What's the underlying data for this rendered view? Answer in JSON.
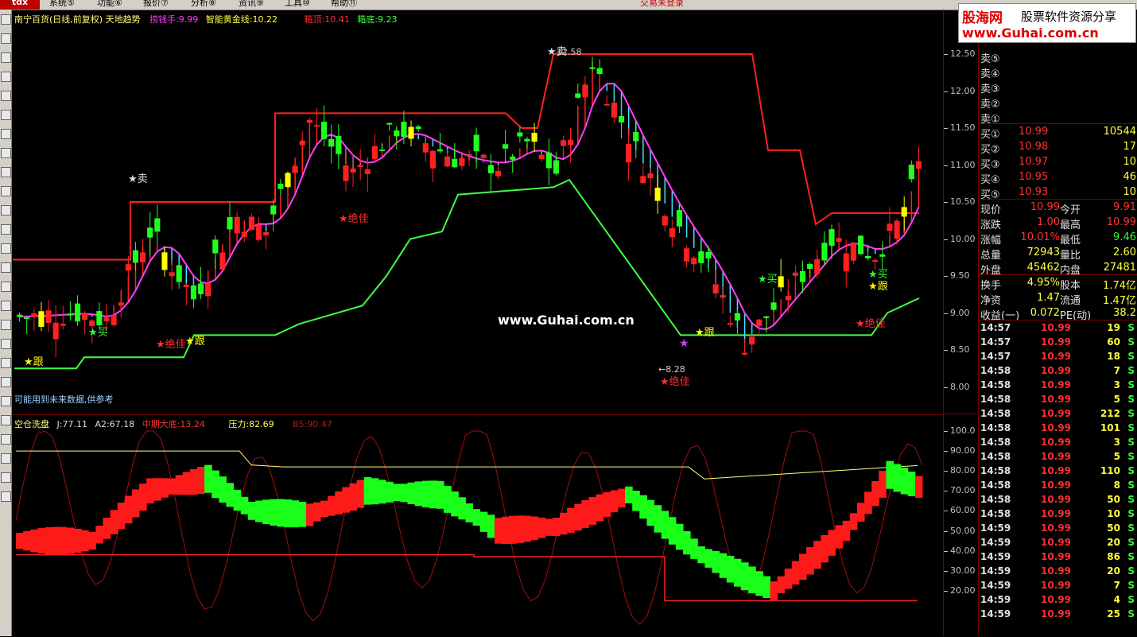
{
  "menu": {
    "items": [
      "系统⑤",
      "功能⑥",
      "报价⑦",
      "分析⑧",
      "资讯⑨",
      "工具⑩",
      "帮助⑪"
    ],
    "login_status": "交易未登录"
  },
  "watermark": {
    "site": "股海网",
    "slogan": "股票软件资源分享",
    "url": "www.Guhai.com.cn"
  },
  "main_header": {
    "title": "南宁百货(日线,前复权) 天地趋势",
    "ind1_label": "捞钱手:",
    "ind1_value": "9.99",
    "ind2_label": "智能黄金线:",
    "ind2_value": "10.22",
    "ind3_label": "箱顶:",
    "ind3_value": "10.41",
    "ind4_label": "箱底:",
    "ind4_value": "9.23"
  },
  "main_footer_note": "可能用到未来数据,供参考",
  "center_watermark": "www.Guhai.com.cn",
  "sub_header": {
    "title": "空仓洗盘",
    "j": "J:77.11",
    "a2": "A2:67.18",
    "mid_label": "中期大底:",
    "mid_value": "13.24",
    "press_label": "压力:",
    "press_value": "82.69",
    "b5": "B5:90.47"
  },
  "annotations": {
    "sell": "★卖",
    "buy": "★买",
    "follow": "★跟",
    "best": "★绝佳",
    "high_mark": "12.58",
    "low_mark": "←8.28"
  },
  "price_axis": [
    "12.50",
    "12.00",
    "11.50",
    "11.00",
    "10.50",
    "10.00",
    "9.50",
    "9.00",
    "8.50",
    "8.00"
  ],
  "sub_axis": [
    "100.0",
    "90.00",
    "80.00",
    "70.00",
    "60.00",
    "50.00",
    "40.00",
    "30.00",
    "20.00"
  ],
  "quote": {
    "sell_labels": [
      "卖⑤",
      "卖④",
      "卖③",
      "卖②",
      "卖①"
    ],
    "buy_levels": [
      {
        "label": "买①",
        "price": "10.99",
        "vol": "10544"
      },
      {
        "label": "买②",
        "price": "10.98",
        "vol": "17"
      },
      {
        "label": "买③",
        "price": "10.97",
        "vol": "10"
      },
      {
        "label": "买④",
        "price": "10.95",
        "vol": "46"
      },
      {
        "label": "买⑤",
        "price": "10.93",
        "vol": "10"
      }
    ],
    "stats": [
      {
        "l1": "现价",
        "v1": "10.99",
        "l2": "今开",
        "v2": "9.91"
      },
      {
        "l1": "涨跌",
        "v1": "1.00",
        "l2": "最高",
        "v2": "10.99"
      },
      {
        "l1": "涨幅",
        "v1": "10.01%",
        "l2": "最低",
        "v2": "9.46"
      },
      {
        "l1": "总量",
        "v1": "72943",
        "l2": "量比",
        "v2": "2.60"
      },
      {
        "l1": "外盘",
        "v1": "45462",
        "l2": "内盘",
        "v2": "27481"
      }
    ],
    "stats2": [
      {
        "l1": "换手",
        "v1": "4.95%",
        "l2": "股本",
        "v2": "1.74亿"
      },
      {
        "l1": "净资",
        "v1": "1.47",
        "l2": "流通",
        "v2": "1.47亿"
      },
      {
        "l1": "收益(一)",
        "v1": "0.072",
        "l2": "PE(动)",
        "v2": "38.2"
      }
    ],
    "ticks": [
      {
        "t": "14:57",
        "p": "10.99",
        "v": "19",
        "s": "S"
      },
      {
        "t": "14:57",
        "p": "10.99",
        "v": "60",
        "s": "S"
      },
      {
        "t": "14:57",
        "p": "10.99",
        "v": "18",
        "s": "S"
      },
      {
        "t": "14:58",
        "p": "10.99",
        "v": "7",
        "s": "S"
      },
      {
        "t": "14:58",
        "p": "10.99",
        "v": "3",
        "s": "S"
      },
      {
        "t": "14:58",
        "p": "10.99",
        "v": "5",
        "s": "S"
      },
      {
        "t": "14:58",
        "p": "10.99",
        "v": "212",
        "s": "S"
      },
      {
        "t": "14:58",
        "p": "10.99",
        "v": "101",
        "s": "S"
      },
      {
        "t": "14:58",
        "p": "10.99",
        "v": "3",
        "s": "S"
      },
      {
        "t": "14:58",
        "p": "10.99",
        "v": "5",
        "s": "S"
      },
      {
        "t": "14:58",
        "p": "10.99",
        "v": "110",
        "s": "S"
      },
      {
        "t": "14:58",
        "p": "10.99",
        "v": "8",
        "s": "S"
      },
      {
        "t": "14:58",
        "p": "10.99",
        "v": "50",
        "s": "S"
      },
      {
        "t": "14:58",
        "p": "10.99",
        "v": "10",
        "s": "S"
      },
      {
        "t": "14:59",
        "p": "10.99",
        "v": "50",
        "s": "S"
      },
      {
        "t": "14:59",
        "p": "10.99",
        "v": "20",
        "s": "S"
      },
      {
        "t": "14:59",
        "p": "10.99",
        "v": "86",
        "s": "S"
      },
      {
        "t": "14:59",
        "p": "10.99",
        "v": "20",
        "s": "S"
      },
      {
        "t": "14:59",
        "p": "10.99",
        "v": "7",
        "s": "S"
      },
      {
        "t": "14:59",
        "p": "10.99",
        "v": "4",
        "s": "S"
      },
      {
        "t": "14:59",
        "p": "10.99",
        "v": "25",
        "s": "S"
      }
    ]
  },
  "colors": {
    "up": "#ff2020",
    "down": "#20ff20",
    "ma": "#ff40ff",
    "box_top": "#ff2020",
    "box_bottom": "#40ff40",
    "accent": "#ffff00"
  }
}
